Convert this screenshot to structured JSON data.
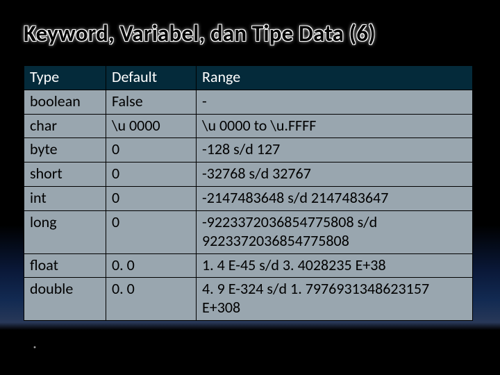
{
  "title": "Keyword, Variabel, dan Tipe Data (6)",
  "chart_data": {
    "type": "table",
    "headers": [
      "Type",
      "Default",
      "Range"
    ],
    "rows": [
      {
        "type": "boolean",
        "default": "False",
        "range": "-"
      },
      {
        "type": "char",
        "default": "\\u 0000",
        "range": "\\u 0000 to \\u.FFFF"
      },
      {
        "type": "byte",
        "default": "0",
        "range": "-128 s/d 127"
      },
      {
        "type": "short",
        "default": "0",
        "range": "-32768 s/d 32767"
      },
      {
        "type": "int",
        "default": "0",
        "range": "-2147483648 s/d 2147483647"
      },
      {
        "type": "long",
        "default": "0",
        "range": "-9223372036854775808 s/d 9223372036854775808"
      },
      {
        "type": "float",
        "default": "0. 0",
        "range": "1. 4 E-45 s/d 3. 4028235 E+38"
      },
      {
        "type": "double",
        "default": "0. 0",
        "range": "4. 9 E-324 s/d 1. 7976931348623157 E+308"
      }
    ]
  }
}
